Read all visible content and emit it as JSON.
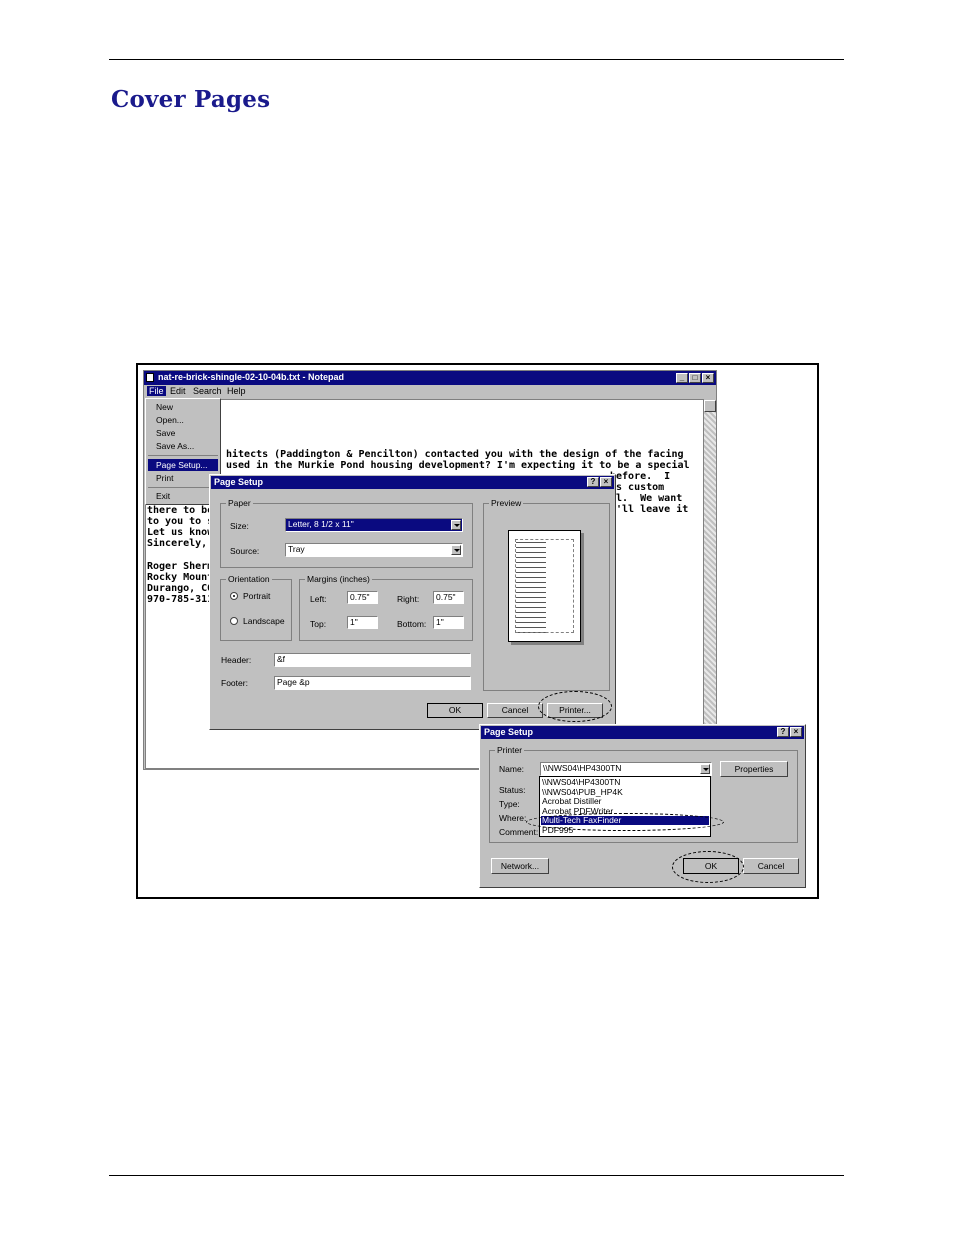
{
  "page": {
    "title": "Cover Pages"
  },
  "notepad": {
    "title": "nat-re-brick-shingle-02-10-04b.txt - Notepad",
    "menubar": [
      "File",
      "Edit",
      "Search",
      "Help"
    ],
    "file_menu": [
      "New",
      "Open...",
      "Save",
      "Save As...",
      "Page Setup...",
      "Print",
      "Exit"
    ],
    "text_top": [
      "hitects (Paddington & Pencilton) contacted you with the design of the facing",
      "used in the Murkie Pond housing development? I'm expecting it to be a special"
    ],
    "text_right": [
      "before.  I",
      "'s custom",
      "al.  We want",
      "e'll leave it"
    ],
    "text_left": [
      "there to be",
      "to you to s",
      "Let us know",
      "Sincerely,",
      "",
      "Roger Sherm",
      "Rocky Mount",
      "Durango, CO",
      "970-785-311"
    ]
  },
  "page_setup": {
    "title": "Page Setup",
    "paper_group": "Paper",
    "size_label": "Size:",
    "size_value": "Letter, 8 1/2 x 11\"",
    "source_label": "Source:",
    "source_value": "Tray",
    "orientation_group": "Orientation",
    "portrait_label": "Portrait",
    "landscape_label": "Landscape",
    "margins_group": "Margins (inches)",
    "left_label": "Left:",
    "left_value": "0.75\"",
    "right_label": "Right:",
    "right_value": "0.75\"",
    "top_label": "Top:",
    "top_value": "1\"",
    "bottom_label": "Bottom:",
    "bottom_value": "1\"",
    "preview_group": "Preview",
    "header_label": "Header:",
    "header_value": "&f",
    "footer_label": "Footer:",
    "footer_value": "Page &p",
    "ok_label": "OK",
    "cancel_label": "Cancel",
    "printer_label": "Printer..."
  },
  "printer_setup": {
    "title": "Page Setup",
    "printer_group": "Printer",
    "name_label": "Name:",
    "name_value": "\\\\NWS04\\HP4300TN",
    "properties_label": "Properties",
    "status_label": "Status:",
    "type_label": "Type:",
    "where_label": "Where:",
    "comment_label": "Comment:",
    "printer_list": [
      "\\\\NWS04\\HP4300TN",
      "\\\\NWS04\\PUB_HP4K",
      "Acrobat Distiller",
      "Acrobat PDFWriter",
      "Multi-Tech FaxFinder",
      "PDF995"
    ],
    "selected_printer": "Multi-Tech FaxFinder",
    "network_label": "Network...",
    "ok_label": "OK",
    "cancel_label": "Cancel"
  }
}
